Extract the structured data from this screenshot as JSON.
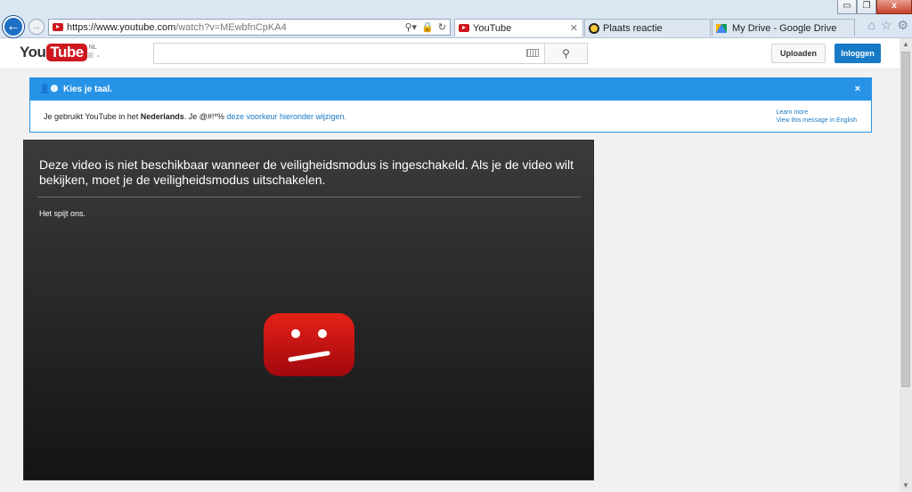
{
  "browser": {
    "address": {
      "url_main": "https://www.youtube.com",
      "url_rest": "/watch?v=MEwbfnCpKA4"
    },
    "tabs": [
      {
        "label": "YouTube",
        "active": true
      },
      {
        "label": "Plaats reactie",
        "active": false
      },
      {
        "label": "My Drive - Google Drive",
        "active": false
      }
    ],
    "window_controls": {
      "minimize": "▭",
      "restore": "❐",
      "close": "x"
    },
    "tools": {
      "home": "⌂",
      "favorites": "☆",
      "settings": "⚙"
    }
  },
  "header": {
    "logo_you": "You",
    "logo_tube": "Tube",
    "logo_region": "NL",
    "guide_icon": "≡ -",
    "search_placeholder": "",
    "upload_label": "Uploaden",
    "login_label": "Inloggen"
  },
  "language_bar": {
    "title": "Kies je taal.",
    "close": "×",
    "msg_start": "Je gebruikt YouTube in het ",
    "msg_lang": "Nederlands",
    "msg_mid": ". Je @#!*% ",
    "msg_link": "deze voorkeur hieronder wijzigen.",
    "learn_more": "Learn more",
    "view_english": "View this message in English"
  },
  "player": {
    "error_title": "Deze video is niet beschikbaar wanneer de veiligheidsmodus is ingeschakeld. Als je de video wilt bekijken, moet je de veiligheidsmodus uitschakelen.",
    "error_sub": "Het spijt ons."
  },
  "colors": {
    "brand_red": "#cc181e",
    "accent_blue": "#2793e6",
    "link_blue": "#167ac6"
  }
}
